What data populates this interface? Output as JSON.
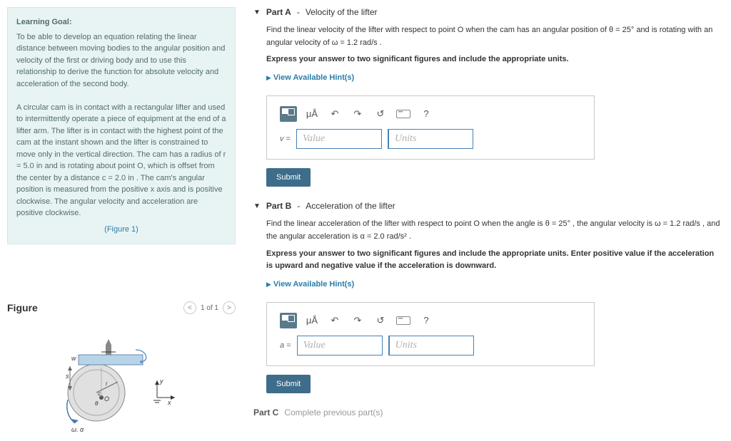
{
  "learning_goal": {
    "title": "Learning Goal:",
    "para1": "To be able to develop an equation relating the linear distance between moving bodies to the angular position and velocity of the first or driving body and to use this relationship to derive the function for absolute velocity and acceleration of the second body.",
    "para2": "A circular cam is in contact with a rectangular lifter and used to intermittently operate a piece of equipment at the end of a lifter arm. The lifter is in contact with the highest point of the cam at the instant shown and the lifter is constrained to move only in the vertical direction. The cam has a radius of r = 5.0 in and is rotating about point O, which is offset from the center by a distance c = 2.0 in . The cam's angular position is measured from the positive x axis and is positive clockwise. The angular velocity and acceleration are positive clockwise.",
    "figure_link": "(Figure 1)"
  },
  "figure": {
    "title": "Figure",
    "counter": "1 of 1"
  },
  "partA": {
    "label": "Part A",
    "subtitle": "Velocity of the lifter",
    "prompt1": "Find the linear velocity of the lifter with respect to point O when the cam has an angular position of θ = 25° and is rotating with an angular velocity of ω = 1.2 rad/s .",
    "prompt2": "Express your answer to two significant figures and include the appropriate units.",
    "hints": "View Available Hint(s)",
    "var": "v =",
    "value_ph": "Value",
    "units_ph": "Units",
    "submit": "Submit"
  },
  "partB": {
    "label": "Part B",
    "subtitle": "Acceleration of the lifter",
    "prompt1": "Find the linear acceleration of the lifter with respect to point O when the angle is θ = 25° , the angular velocity is ω = 1.2 rad/s , and the angular acceleration is α = 2.0 rad/s² .",
    "prompt2": "Express your answer to two significant figures and include the appropriate units. Enter positive value if the acceleration is upward and negative value if the acceleration is downward.",
    "hints": "View Available Hint(s)",
    "var": "a =",
    "value_ph": "Value",
    "units_ph": "Units",
    "submit": "Submit"
  },
  "partC": {
    "label": "Part C",
    "text": "Complete previous part(s)"
  },
  "toolbar": {
    "mu_a": "μÅ",
    "undo": "↶",
    "redo": "↷",
    "reset": "↺",
    "help": "?"
  }
}
